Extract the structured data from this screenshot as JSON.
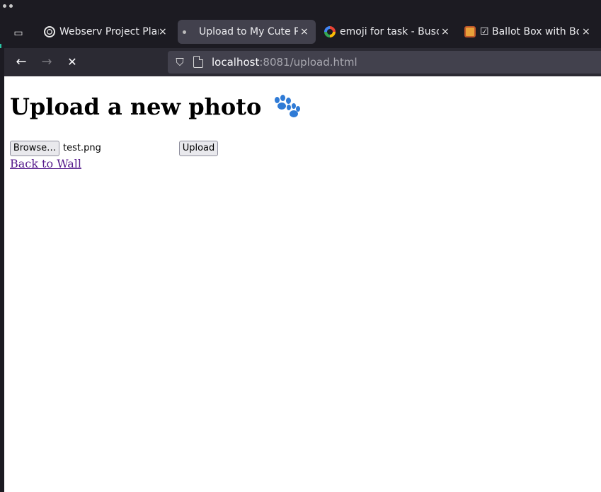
{
  "browser": {
    "tabs": [
      {
        "title": "Webserv Project Plan",
        "close": "×",
        "favicon": "openai-icon",
        "active": false
      },
      {
        "title": "Upload to My Cute Ph",
        "close": "×",
        "favicon": "loading-dot-icon",
        "active": true
      },
      {
        "title": "emoji for task - Busca",
        "close": "×",
        "favicon": "google-icon",
        "active": false
      },
      {
        "title": "☑ Ballot Box with Bol",
        "close": "×",
        "favicon": "emoji-site-icon",
        "active": false
      }
    ],
    "url": {
      "host": "localhost",
      "rest": ":8081/upload.html"
    },
    "icons": {
      "back": "←",
      "forward": "→",
      "stop": "✕",
      "tab_overview": "▭",
      "shield": "⛉"
    }
  },
  "page": {
    "title": "Upload a new photo",
    "title_emoji": "paw-prints-icon",
    "file_input": {
      "button_label": "Browse…",
      "filename": "test.png"
    },
    "upload_button": "Upload",
    "back_link": "Back to Wall"
  },
  "colors": {
    "chrome_dark": "#1c1b22",
    "toolbar": "#2b2a33",
    "active_tab": "#42414d",
    "link_visited": "#551a8b",
    "paw_blue": "#2f7bd6"
  }
}
